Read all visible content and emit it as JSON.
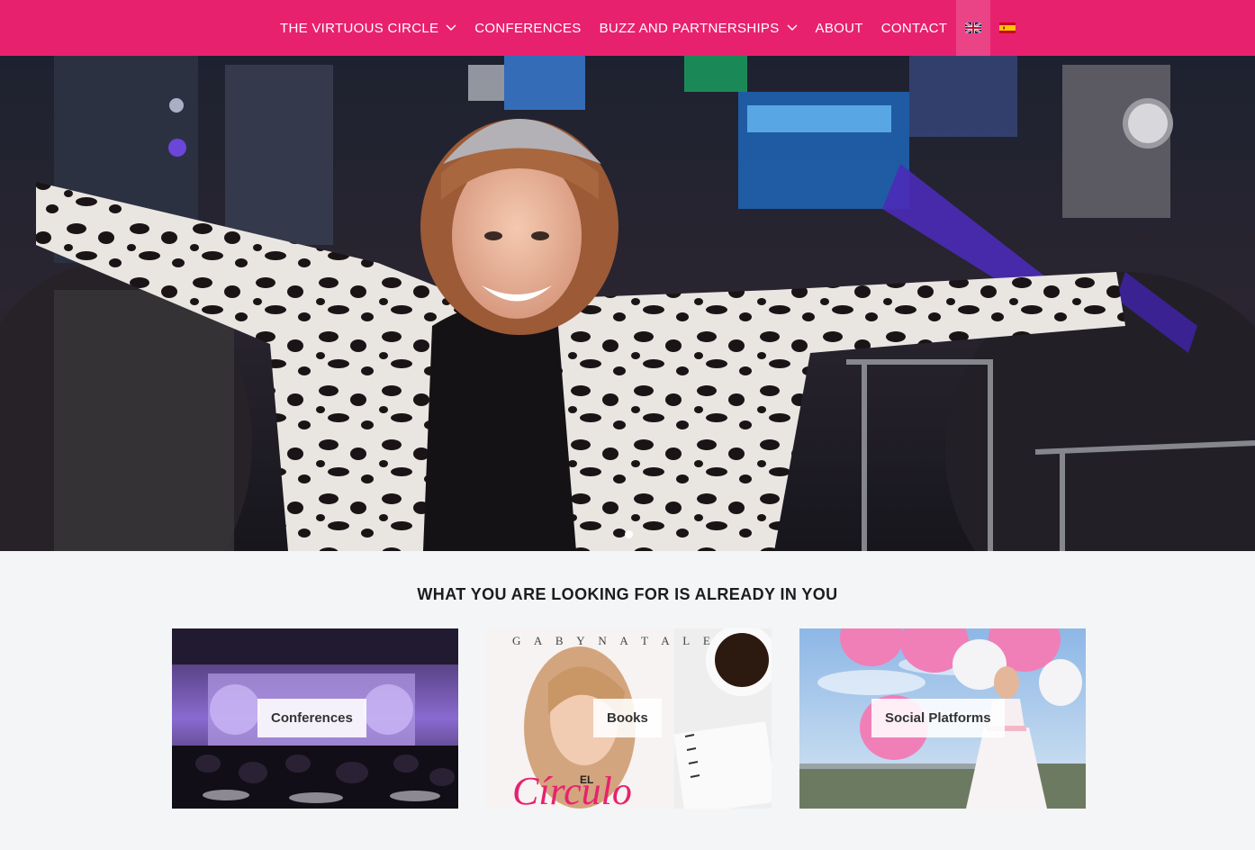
{
  "nav": {
    "items": [
      {
        "label": "THE VIRTUOUS CIRCLE",
        "has_dropdown": true
      },
      {
        "label": "CONFERENCES",
        "has_dropdown": false
      },
      {
        "label": "BUZZ AND PARTNERSHIPS",
        "has_dropdown": true
      },
      {
        "label": "ABOUT",
        "has_dropdown": false
      },
      {
        "label": "CONTACT",
        "has_dropdown": false
      }
    ],
    "languages": [
      {
        "code": "en",
        "icon": "uk-flag-icon",
        "active": true
      },
      {
        "code": "es",
        "icon": "spain-flag-icon",
        "active": false
      }
    ],
    "background_color": "#e8216f"
  },
  "hero": {
    "image": "woman-in-leopard-coat-times-square-photo",
    "slide_count": 1,
    "active_slide": 1
  },
  "section": {
    "tagline": "WHAT YOU ARE LOOKING FOR IS ALREADY IN YOU",
    "cards": [
      {
        "label": "Conferences",
        "image": "conference-hall-photo"
      },
      {
        "label": "Books",
        "image": "book-cover-photo"
      },
      {
        "label": "Social Platforms",
        "image": "pink-balloons-photo"
      }
    ]
  }
}
